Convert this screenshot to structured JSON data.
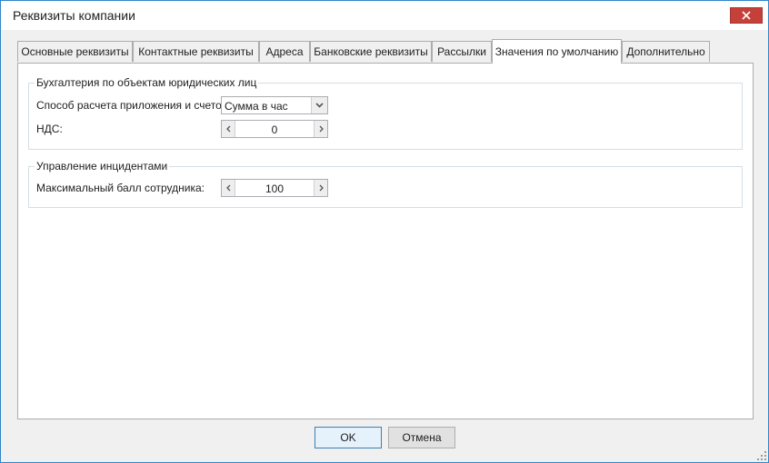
{
  "window": {
    "title": "Реквизиты компании"
  },
  "tabs": [
    {
      "label": "Основные реквизиты"
    },
    {
      "label": "Контактные реквизиты"
    },
    {
      "label": "Адреса"
    },
    {
      "label": "Банковские реквизиты"
    },
    {
      "label": "Рассылки"
    },
    {
      "label": "Значения по умолчанию",
      "active": true
    },
    {
      "label": "Дополнительно"
    }
  ],
  "accounting": {
    "title": "Бухгалтерия по объектам юридических лиц",
    "calc_method_label": "Способ расчета приложения и счетов:",
    "calc_method_value": "Сумма в час",
    "vat_label": "НДС:",
    "vat_value": "0"
  },
  "incidents": {
    "title": "Управление инцидентами",
    "max_score_label": "Максимальный балл сотрудника:",
    "max_score_value": "100"
  },
  "buttons": {
    "ok": "OK",
    "cancel": "Отмена"
  },
  "icons": {
    "close": "close-icon",
    "combo_arrow": "chevron-down-icon",
    "spin_left": "chevron-left-icon",
    "spin_right": "chevron-right-icon",
    "resize": "resize-grip-icon"
  },
  "colors": {
    "close_button": "#c6403a",
    "window_border": "#2f86c8",
    "ok_border": "#3c7fb1"
  }
}
